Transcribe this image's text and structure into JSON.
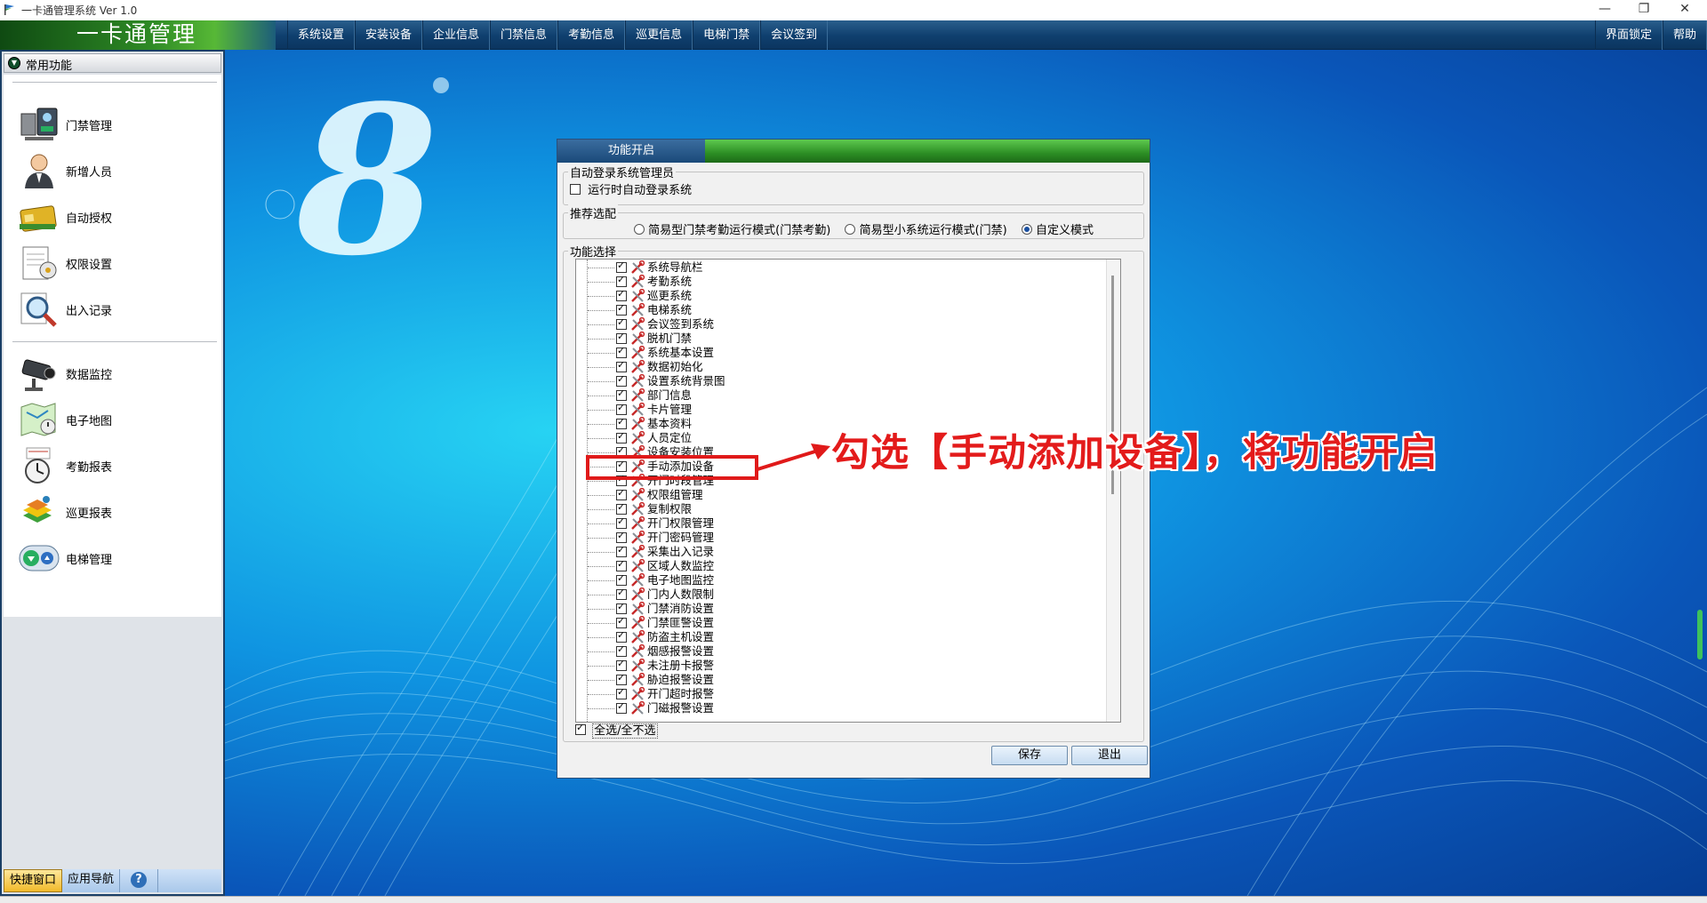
{
  "window": {
    "title": "一卡通管理系统 Ver 1.0",
    "minimize_glyph": "—",
    "restore_glyph": "❐",
    "close_glyph": "✕"
  },
  "app_logo_text": "一卡通管理",
  "menu": {
    "items": [
      "系统设置",
      "安装设备",
      "企业信息",
      "门禁信息",
      "考勤信息",
      "巡更信息",
      "电梯门禁",
      "会议签到"
    ],
    "right": [
      "界面锁定",
      "帮助"
    ]
  },
  "sidebar": {
    "header": "常用功能",
    "group1": [
      {
        "label": "门禁管理",
        "icon": "access-control-icon"
      },
      {
        "label": "新增人员",
        "icon": "person-icon"
      },
      {
        "label": "自动授权",
        "icon": "card-icon"
      },
      {
        "label": "权限设置",
        "icon": "permission-doc-icon"
      },
      {
        "label": "出入记录",
        "icon": "magnifier-icon"
      }
    ],
    "group2": [
      {
        "label": "数据监控",
        "icon": "camera-icon"
      },
      {
        "label": "电子地图",
        "icon": "map-icon"
      },
      {
        "label": "考勤报表",
        "icon": "clock-icon"
      },
      {
        "label": "巡更报表",
        "icon": "patrol-icon"
      },
      {
        "label": "电梯管理",
        "icon": "elevator-icon"
      }
    ],
    "tabs": [
      "快捷窗口",
      "应用导航"
    ]
  },
  "dialog": {
    "tab": "功能开启",
    "autologin": {
      "group_title": "自动登录系统管理员",
      "checkbox_label": "运行时自动登录系统",
      "checked": false
    },
    "preset": {
      "group_title": "推荐选配",
      "options": [
        "简易型门禁考勤运行模式(门禁考勤)",
        "简易型小系统运行模式(门禁)",
        "自定义模式"
      ],
      "selected": "自定义模式"
    },
    "functions": {
      "group_title": "功能选择",
      "items": [
        "系统导航栏",
        "考勤系统",
        "巡更系统",
        "电梯系统",
        "会议签到系统",
        "脱机门禁",
        "系统基本设置",
        "数据初始化",
        "设置系统背景图",
        "部门信息",
        "卡片管理",
        "基本资料",
        "人员定位",
        "设备安装位置",
        "手动添加设备",
        "开门时段管理",
        "权限组管理",
        "复制权限",
        "开门权限管理",
        "开门密码管理",
        "采集出入记录",
        "区域人数监控",
        "电子地图监控",
        "门内人数限制",
        "门禁消防设置",
        "门禁匪警设置",
        "防盗主机设置",
        "烟感报警设置",
        "未注册卡报警",
        "胁迫报警设置",
        "开门超时报警",
        "门磁报警设置"
      ],
      "select_all_label": "全选/全不选",
      "select_all_checked": true
    },
    "buttons": {
      "save": "保存",
      "exit": "退出"
    }
  },
  "annotation": {
    "text": "勾选【手动添加设备】，将功能开启",
    "color": "#e31b1b"
  },
  "help_glyph": "?",
  "colors": {
    "menubar": "#0f3f6e",
    "desktop": "#0f94e1",
    "annotation": "#e01a1a"
  }
}
